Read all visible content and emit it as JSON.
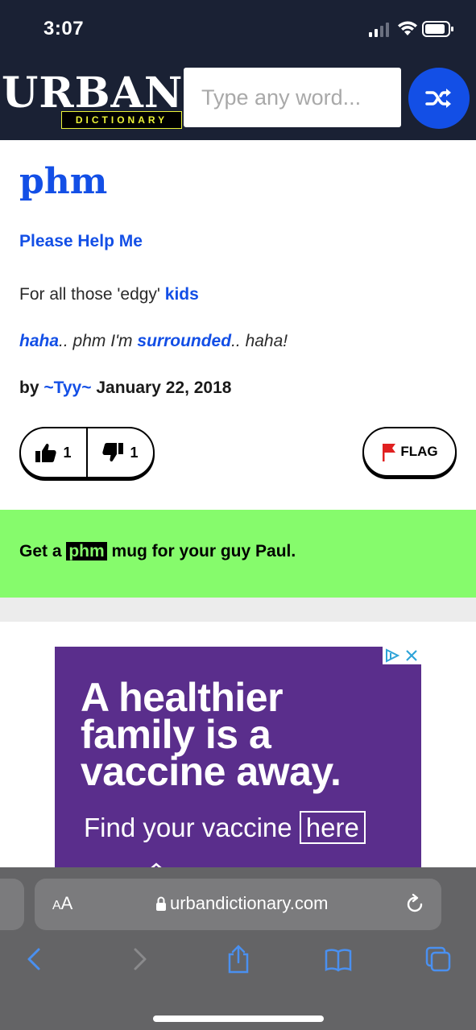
{
  "status_bar": {
    "time": "3:07"
  },
  "header": {
    "logo_word": "URBAN",
    "logo_sub": "DICTIONARY",
    "search_placeholder": "Type any word..."
  },
  "definition": {
    "word": "phm",
    "meaning": "Please Help Me",
    "text_before": "For all those 'edgy' ",
    "text_link": "kids",
    "example_link1": "haha",
    "example_mid": ".. phm I'm ",
    "example_link2": "surrounded",
    "example_end": ".. haha!",
    "by_prefix": "by ",
    "author": "~Tyy~",
    "date": "January 22, 2018",
    "upvotes": "1",
    "downvotes": "1",
    "flag_label": "FLAG"
  },
  "mug": {
    "prefix": "Get a ",
    "word": "phm",
    "suffix": " mug for your guy Paul."
  },
  "ad": {
    "line1": "A healthier",
    "line2": "family is a",
    "line3": "vaccine away.",
    "cta_text": "Find your vaccine ",
    "cta_link": "here"
  },
  "browser": {
    "aa_small": "A",
    "aa_large": "A",
    "url": "urbandictionary.com"
  },
  "colors": {
    "brand_blue": "#134fe6",
    "header_bg": "#1a2134",
    "mug_green": "#86fb6c",
    "ad_purple": "#5a2e8c"
  }
}
